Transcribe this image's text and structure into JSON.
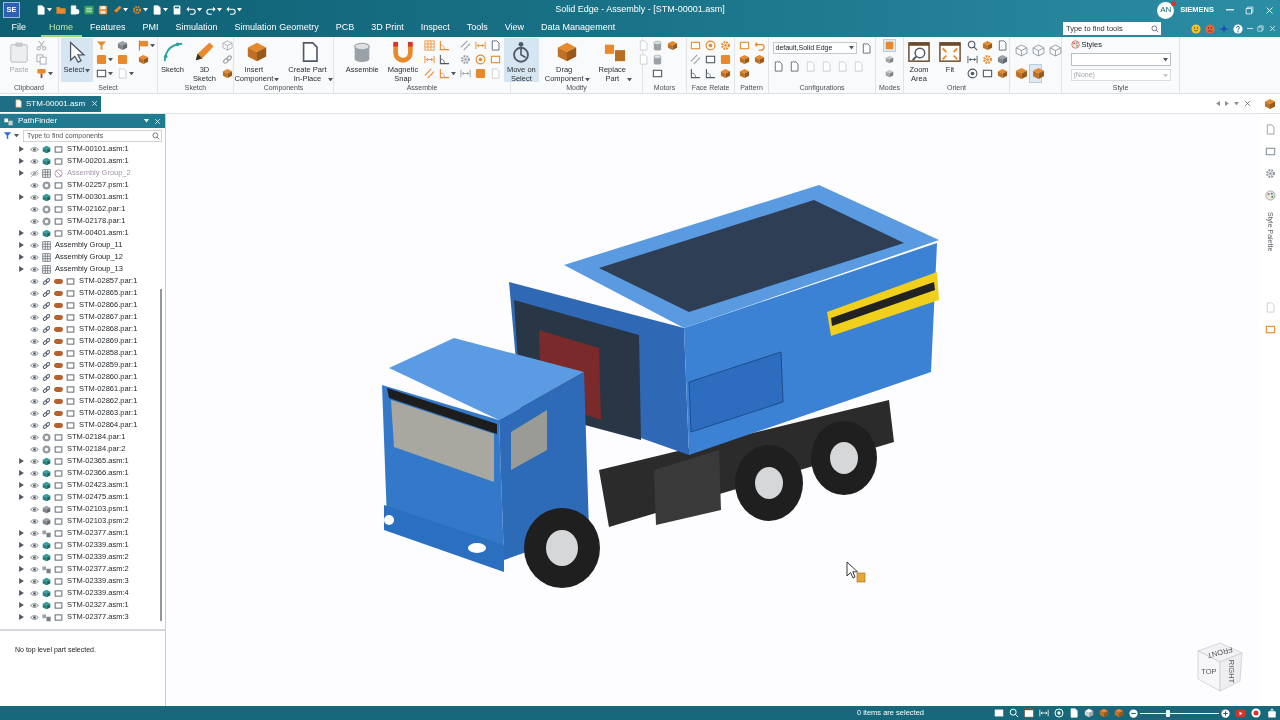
{
  "title_bar": {
    "logo": "SE",
    "title": "Solid Edge - Assembly - [STM-00001.asm]",
    "user": {
      "initials": "AN",
      "notification": true
    },
    "brand": "SIEMENS"
  },
  "menu_tabs": [
    {
      "label": "File",
      "selected": false
    },
    {
      "label": "Home",
      "selected": true
    },
    {
      "label": "Features",
      "selected": false
    },
    {
      "label": "PMI",
      "selected": false
    },
    {
      "label": "Simulation",
      "selected": false
    },
    {
      "label": "Simulation Geometry",
      "selected": false
    },
    {
      "label": "PCB",
      "selected": false
    },
    {
      "label": "3D Print",
      "selected": false
    },
    {
      "label": "Inspect",
      "selected": false
    },
    {
      "label": "Tools",
      "selected": false
    },
    {
      "label": "View",
      "selected": false
    },
    {
      "label": "Data Management",
      "selected": false
    }
  ],
  "tool_search": {
    "placeholder": "Type to find tools"
  },
  "ribbon": {
    "groups": [
      {
        "label": "Clipboard",
        "buttons": [
          {
            "label": "Paste",
            "selected": false,
            "disabled": true,
            "has_menu": false
          }
        ]
      },
      {
        "label": "Select",
        "buttons": [
          {
            "label": "Select",
            "selected": true,
            "disabled": false,
            "has_menu": true
          }
        ]
      },
      {
        "label": "Sketch",
        "buttons": [
          {
            "label": "Sketch",
            "selected": false,
            "disabled": false,
            "has_menu": false
          },
          {
            "label": "3D\nSketch",
            "selected": false,
            "disabled": false,
            "has_menu": false
          }
        ]
      },
      {
        "label": "Components",
        "buttons": [
          {
            "label": "Insert\nComponent",
            "selected": false,
            "disabled": false,
            "has_menu": true
          },
          {
            "label": "Create Part\nIn-Place",
            "selected": false,
            "disabled": false,
            "has_menu": true
          }
        ]
      },
      {
        "label": "Assemble",
        "buttons": [
          {
            "label": "Assemble",
            "selected": false,
            "disabled": false,
            "has_menu": false
          },
          {
            "label": "Magnetic\nSnap",
            "selected": false,
            "disabled": false,
            "has_menu": false
          }
        ]
      },
      {
        "label": "Modify",
        "buttons": [
          {
            "label": "Move on\nSelect",
            "selected": true,
            "disabled": false,
            "has_menu": false
          },
          {
            "label": "Drag\nComponent",
            "selected": false,
            "disabled": false,
            "has_menu": true
          },
          {
            "label": "Replace\nPart",
            "selected": false,
            "disabled": false,
            "has_menu": true
          }
        ]
      },
      {
        "label": "Motors"
      },
      {
        "label": "Face Relate"
      },
      {
        "label": "Pattern"
      },
      {
        "label": "Configurations",
        "dropdown": "default,Solid Edge"
      },
      {
        "label": "Modes",
        "toggles": [
          {
            "selected": true
          },
          {
            "selected": false
          },
          {
            "selected": false
          }
        ]
      },
      {
        "label": "Orient",
        "buttons": [
          {
            "label": "Zoom\nArea",
            "selected": false,
            "disabled": false,
            "has_menu": false
          },
          {
            "label": "Fit",
            "selected": false,
            "disabled": false,
            "has_menu": false
          }
        ]
      },
      {
        "toggles": [
          {
            "selected": false
          },
          {
            "selected": false
          },
          {
            "selected": false
          },
          {
            "selected": false
          },
          {
            "selected": true
          }
        ]
      },
      {
        "label": "Style",
        "style": {
          "heading": "Styles",
          "value": "(None)"
        }
      }
    ]
  },
  "document_tabs": [
    {
      "label": "STM-00001.asm",
      "selected": true
    }
  ],
  "pathfinder": {
    "title": "PathFinder",
    "search": {
      "placeholder": "Type to find components"
    },
    "items": [
      {
        "label": "STM-00101.asm:1",
        "kind": "assembly",
        "expandable": true,
        "visible": true
      },
      {
        "label": "STM-00201.asm:1",
        "kind": "assembly",
        "expandable": true,
        "visible": true
      },
      {
        "label": "Assembly Group_2",
        "kind": "group",
        "expandable": true,
        "visible": false
      },
      {
        "label": "STM-02257.psm:1",
        "kind": "part",
        "expandable": false,
        "visible": true
      },
      {
        "label": "STM-00301.asm:1",
        "kind": "assembly",
        "expandable": true,
        "visible": true
      },
      {
        "label": "STM-02162.par:1",
        "kind": "part",
        "expandable": false,
        "visible": true
      },
      {
        "label": "STM-02178.par:1",
        "kind": "part",
        "expandable": false,
        "visible": true
      },
      {
        "label": "STM-00401.asm:1",
        "kind": "assembly",
        "expandable": true,
        "visible": true
      },
      {
        "label": "Assembly Group_11",
        "kind": "group",
        "expandable": true,
        "visible": true
      },
      {
        "label": "Assembly Group_12",
        "kind": "group",
        "expandable": true,
        "visible": true
      },
      {
        "label": "Assembly Group_13",
        "kind": "group",
        "expandable": true,
        "visible": true
      },
      {
        "label": "STM-02857.par:1",
        "kind": "linked",
        "expandable": false,
        "visible": true
      },
      {
        "label": "STM-02865.par:1",
        "kind": "linked",
        "expandable": false,
        "visible": true
      },
      {
        "label": "STM-02866.par:1",
        "kind": "linked",
        "expandable": false,
        "visible": true
      },
      {
        "label": "STM-02867.par:1",
        "kind": "linked",
        "expandable": false,
        "visible": true
      },
      {
        "label": "STM-02868.par:1",
        "kind": "linked",
        "expandable": false,
        "visible": true
      },
      {
        "label": "STM-02869.par:1",
        "kind": "linked",
        "expandable": false,
        "visible": true
      },
      {
        "label": "STM-02858.par:1",
        "kind": "linked",
        "expandable": false,
        "visible": true
      },
      {
        "label": "STM-02859.par:1",
        "kind": "linked",
        "expandable": false,
        "visible": true
      },
      {
        "label": "STM-02860.par:1",
        "kind": "linked",
        "expandable": false,
        "visible": true
      },
      {
        "label": "STM-02861.par:1",
        "kind": "linked",
        "expandable": false,
        "visible": true
      },
      {
        "label": "STM-02862.par:1",
        "kind": "linked",
        "expandable": false,
        "visible": true
      },
      {
        "label": "STM-02863.par:1",
        "kind": "linked",
        "expandable": false,
        "visible": true
      },
      {
        "label": "STM-02864.par:1",
        "kind": "linked",
        "expandable": false,
        "visible": true
      },
      {
        "label": "STM-02184.par:1",
        "kind": "part",
        "expandable": false,
        "visible": true
      },
      {
        "label": "STM-02184.par:2",
        "kind": "part",
        "expandable": false,
        "visible": true
      },
      {
        "label": "STM-02365.asm:1",
        "kind": "assembly",
        "expandable": true,
        "visible": true
      },
      {
        "label": "STM-02366.asm:1",
        "kind": "assembly",
        "expandable": true,
        "visible": true
      },
      {
        "label": "STM-02423.asm:1",
        "kind": "assembly",
        "expandable": true,
        "visible": true
      },
      {
        "label": "STM-02475.asm:1",
        "kind": "assembly",
        "expandable": true,
        "visible": true
      },
      {
        "label": "STM-02103.psm:1",
        "kind": "sheetmetal",
        "expandable": false,
        "visible": true
      },
      {
        "label": "STM-02103.psm:2",
        "kind": "sheetmetal",
        "expandable": false,
        "visible": true
      },
      {
        "label": "STM-02377.asm:1",
        "kind": "frame",
        "expandable": true,
        "visible": true
      },
      {
        "label": "STM-02339.asm:1",
        "kind": "assembly",
        "expandable": true,
        "visible": true
      },
      {
        "label": "STM-02339.asm:2",
        "kind": "assembly",
        "expandable": true,
        "visible": true
      },
      {
        "label": "STM-02377.asm:2",
        "kind": "frame",
        "expandable": true,
        "visible": true
      },
      {
        "label": "STM-02339.asm:3",
        "kind": "assembly",
        "expandable": true,
        "visible": true
      },
      {
        "label": "STM-02339.asm:4",
        "kind": "assembly",
        "expandable": true,
        "visible": true
      },
      {
        "label": "STM-02327.asm:1",
        "kind": "assembly",
        "expandable": true,
        "visible": true
      },
      {
        "label": "STM-02377.asm:3",
        "kind": "frame",
        "expandable": true,
        "visible": true
      }
    ],
    "status": "No top level part selected."
  },
  "right_panel": {
    "label": "Style Palette"
  },
  "view_cube": {
    "labels": [
      "FRONT",
      "TOP",
      "RIGHT"
    ]
  },
  "status_bar": {
    "message": "0 items are selected",
    "zoom": {
      "level": 0.33
    }
  }
}
